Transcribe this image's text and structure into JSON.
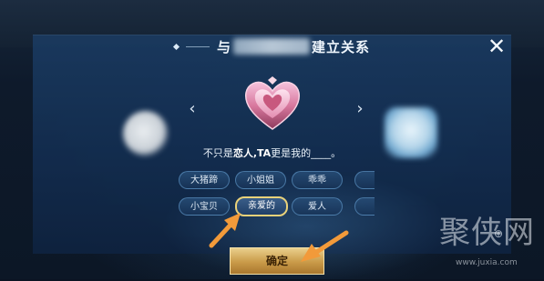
{
  "dialog": {
    "title_prefix": "与",
    "title_suffix": "建立关系",
    "close_label": "✕"
  },
  "nav": {
    "prev_label": "‹",
    "next_label": "›"
  },
  "question": {
    "prefix": "不只是",
    "emphasis": "恋人,TA",
    "suffix": "更是我的____。"
  },
  "options": {
    "row1": [
      "大猪蹄",
      "小姐姐",
      "乖乖"
    ],
    "row2": [
      "小宝贝",
      "亲爱的",
      "爱人"
    ],
    "selected": "亲爱的"
  },
  "confirm_label": "确定",
  "watermark": {
    "text": "聚侠网",
    "url": "www.juxia.com"
  },
  "colors": {
    "accent_gold": "#e9d27a",
    "pointer_orange": "#f29a3a",
    "panel_blue": "#1a3a60"
  }
}
